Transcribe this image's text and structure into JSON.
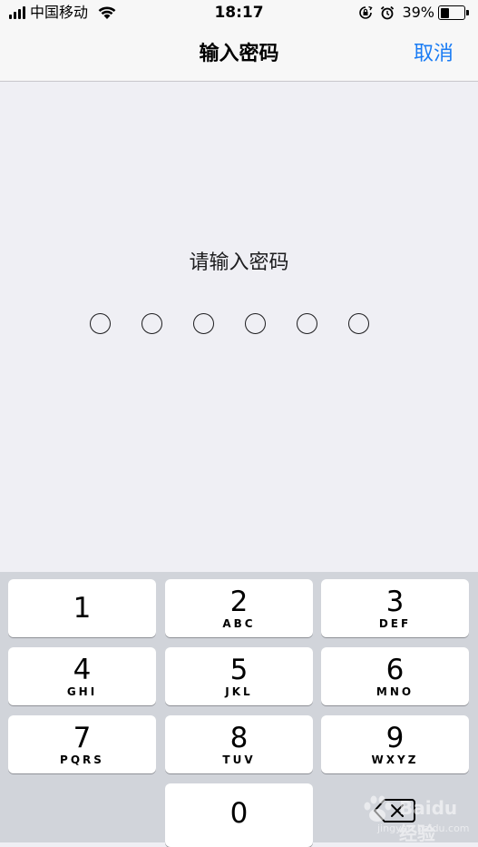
{
  "status_bar": {
    "carrier": "中国移动",
    "time": "18:17",
    "battery_percent": "39%",
    "battery_level": 0.39,
    "icons": [
      "signal-icon",
      "wifi-icon",
      "orientation-lock-icon",
      "alarm-icon",
      "battery-icon"
    ]
  },
  "nav": {
    "title": "输入密码",
    "cancel_label": "取消",
    "accent_color": "#1a7cf4"
  },
  "prompt": {
    "label": "请输入密码",
    "digit_slots": 6,
    "filled": 0
  },
  "keypad": {
    "keys": [
      {
        "num": "1",
        "letters": ""
      },
      {
        "num": "2",
        "letters": "ABC"
      },
      {
        "num": "3",
        "letters": "DEF"
      },
      {
        "num": "4",
        "letters": "GHI"
      },
      {
        "num": "5",
        "letters": "JKL"
      },
      {
        "num": "6",
        "letters": "MNO"
      },
      {
        "num": "7",
        "letters": "PQRS"
      },
      {
        "num": "8",
        "letters": "TUV"
      },
      {
        "num": "9",
        "letters": "WXYZ"
      },
      {
        "num": "0",
        "letters": ""
      }
    ],
    "delete_icon": "backspace-icon"
  },
  "watermark": {
    "text": "Baidu经验",
    "sub": "jingyan.baidu.com"
  }
}
